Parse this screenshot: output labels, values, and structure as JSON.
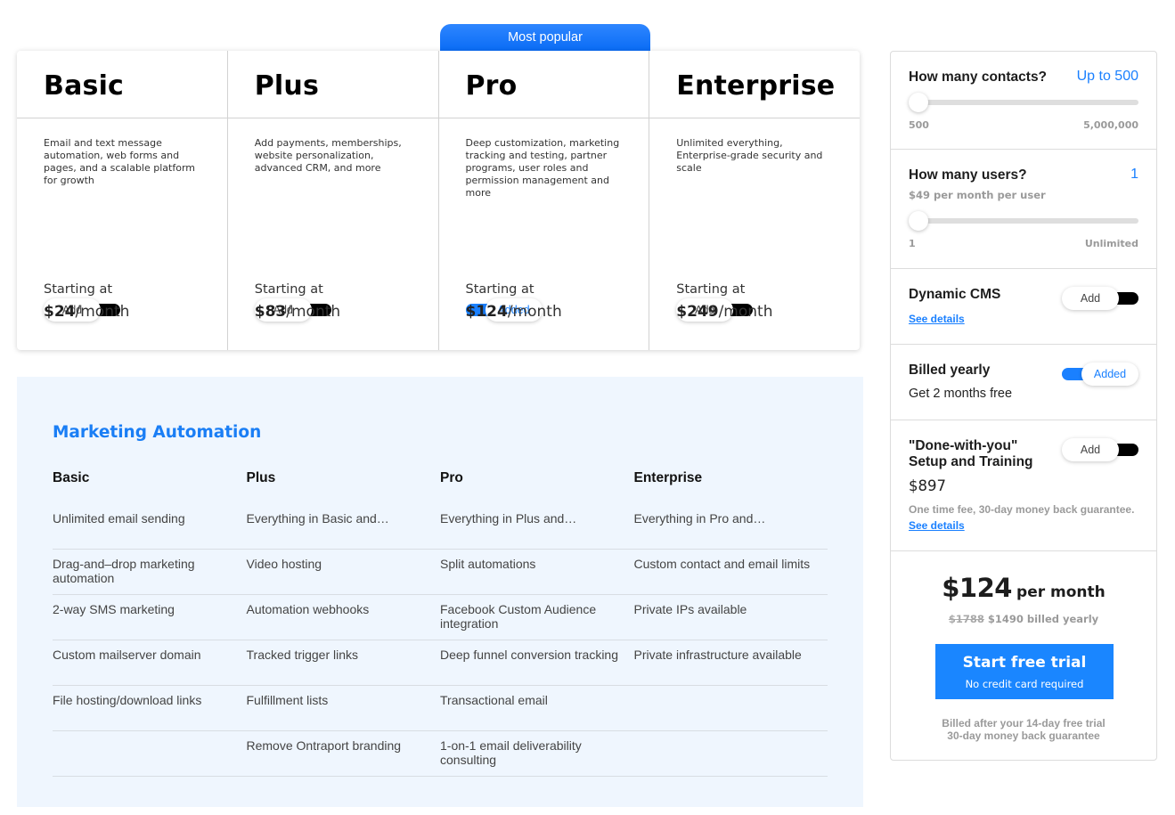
{
  "popular_badge": "Most popular",
  "plans": [
    {
      "name": "Basic",
      "description": "Email and text message automation, web forms and pages, and a scalable platform for growth",
      "toggle_label": "Add",
      "toggle_on": false,
      "starting_label": "Starting at",
      "price": "$24",
      "period": "/month"
    },
    {
      "name": "Plus",
      "description": "Add payments, memberships, website personalization, advanced CRM, and more",
      "toggle_label": "Add",
      "toggle_on": false,
      "starting_label": "Starting at",
      "price": "$83",
      "period": "/month"
    },
    {
      "name": "Pro",
      "description": "Deep customization, marketing tracking and testing, partner programs, user roles and permission management and more",
      "toggle_label": "Added",
      "toggle_on": true,
      "starting_label": "Starting at",
      "price": "$124",
      "period": "/month"
    },
    {
      "name": "Enterprise",
      "description": "Unlimited everything, Enterprise-grade security and scale",
      "toggle_label": "Add",
      "toggle_on": false,
      "starting_label": "Starting at",
      "price": "$249",
      "period": "/month"
    }
  ],
  "features": {
    "title": "Marketing Automation",
    "columns": [
      "Basic",
      "Plus",
      "Pro",
      "Enterprise"
    ],
    "rows": [
      [
        "Unlimited email sending",
        "Everything in Basic and…",
        "Everything in Plus and…",
        "Everything in Pro and…"
      ],
      [
        "Drag-and–drop marketing automation",
        "Video hosting",
        "Split automations",
        "Custom contact and email limits"
      ],
      [
        "2-way SMS marketing",
        "Automation webhooks",
        "Facebook Custom Audience integration",
        "Private IPs available"
      ],
      [
        "Custom mailserver domain",
        "Tracked trigger links",
        "Deep funnel conversion tracking",
        "Private infrastructure available"
      ],
      [
        "File hosting/download links",
        "Fulfillment lists",
        "Transactional email",
        ""
      ],
      [
        "",
        "Remove Ontraport branding",
        "1-on-1 email deliverability consulting",
        ""
      ]
    ]
  },
  "sidebar": {
    "contacts": {
      "label": "How many contacts?",
      "value": "Up to 500",
      "min": "500",
      "max": "5,000,000",
      "slider_fraction": 0
    },
    "users": {
      "label": "How many users?",
      "value": "1",
      "sub": "$49 per month per user",
      "min": "1",
      "max": "Unlimited",
      "slider_fraction": 0
    },
    "cms": {
      "label": "Dynamic CMS",
      "link": "See details",
      "toggle_label": "Add",
      "toggle_on": false
    },
    "billing": {
      "label": "Billed yearly",
      "note": "Get 2 months free",
      "toggle_label": "Added",
      "toggle_on": true
    },
    "setup": {
      "label_line1": "\"Done-with-you\"",
      "label_line2": "Setup and Training",
      "price": "$897",
      "note": "One time fee, 30-day money back guarantee.",
      "link": "See details",
      "toggle_label": "Add",
      "toggle_on": false
    },
    "summary": {
      "amount": "$124",
      "per": "per month",
      "old_yearly": "$1788",
      "new_yearly": "$1490 billed yearly",
      "cta_main": "Start free trial",
      "cta_sub": "No credit card required",
      "fine_line1": "Billed after your 14-day free trial",
      "fine_line2": "30-day money back guarantee"
    }
  },
  "colors": {
    "accent": "#1a80ff",
    "feature_bg": "#eff6fe",
    "toggle_off_track": "#000000"
  }
}
